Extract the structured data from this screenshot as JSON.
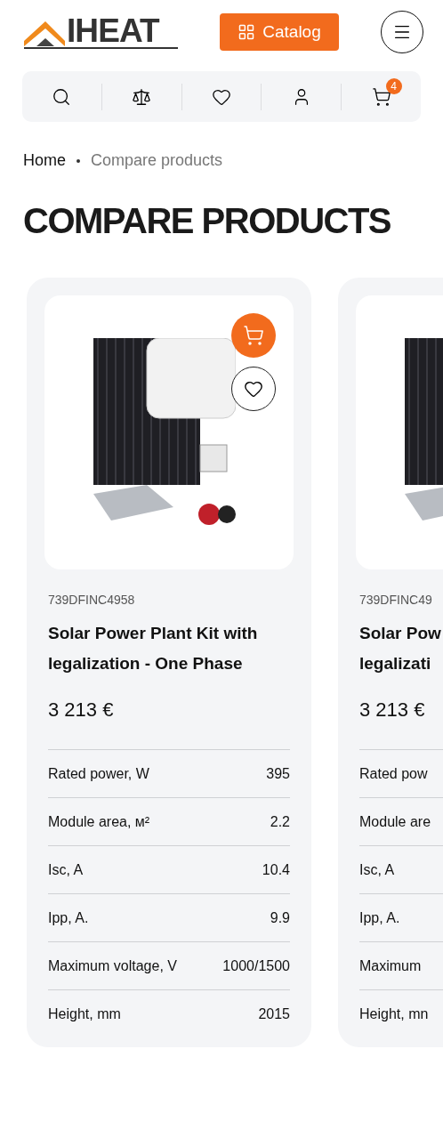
{
  "header": {
    "logo": "IHEAT",
    "catalog_button": "Catalog"
  },
  "toolbar": {
    "cart_count": "4"
  },
  "breadcrumbs": [
    {
      "label": "Home",
      "current": false
    },
    {
      "label": "Compare products",
      "current": true
    }
  ],
  "page_title": "COMPARE PRODUCTS",
  "products": [
    {
      "sku": "739DFINC4958",
      "name": [
        "Solar Power Plant Kit with",
        "legalization - One Phase"
      ],
      "price": "3 213 €",
      "specs": [
        {
          "label": "Rated power, W",
          "value": "395"
        },
        {
          "label": "Module area, м²",
          "value": "2.2"
        },
        {
          "label": "Isc, A",
          "value": "10.4"
        },
        {
          "label": "Ipp, A.",
          "value": "9.9"
        },
        {
          "label": "Maximum voltage, V",
          "value": "1000/1500"
        },
        {
          "label": "Height, mm",
          "value": "2015"
        }
      ]
    },
    {
      "sku": "739DFINC49",
      "name": [
        "Solar Pow",
        "legalizati"
      ],
      "price": "3 213 €",
      "specs": [
        {
          "label": "Rated pow"
        },
        {
          "label": "Module are"
        },
        {
          "label": "Isc, A"
        },
        {
          "label": "Ipp, A."
        },
        {
          "label": "Maximum"
        },
        {
          "label": "Height, mn"
        }
      ]
    }
  ]
}
